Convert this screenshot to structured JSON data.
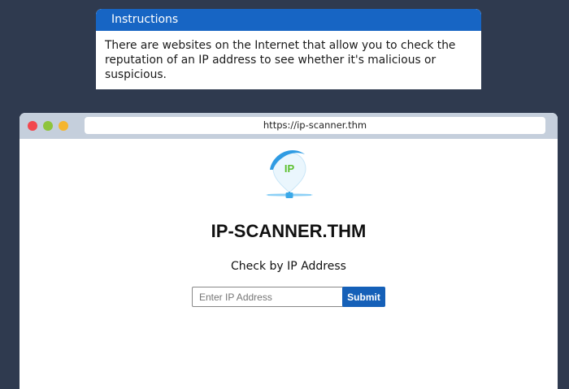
{
  "instructions": {
    "header": "Instructions",
    "body": "There are websites on the Internet that allow you to check the reputation of an IP address to see whether it's malicious or suspicious."
  },
  "browser": {
    "url": "https://ip-scanner.thm",
    "window_controls": [
      "close",
      "minimize",
      "maximize"
    ]
  },
  "page": {
    "logo_text": "IP",
    "title": "IP-SCANNER.THM",
    "subtitle": "Check by IP Address",
    "input_value": "",
    "input_placeholder": "Enter IP Address",
    "submit_label": "Submit"
  },
  "colors": {
    "background": "#2f3a4f",
    "instructions_header": "#1765c4",
    "titlebar": "#c5cfdc",
    "submit": "#1560b8",
    "dot_red": "#f2474e",
    "dot_green": "#8ec43b",
    "dot_yellow": "#f5b52e",
    "logo_green": "#5bbf2c",
    "logo_blue": "#3aa8e8"
  }
}
